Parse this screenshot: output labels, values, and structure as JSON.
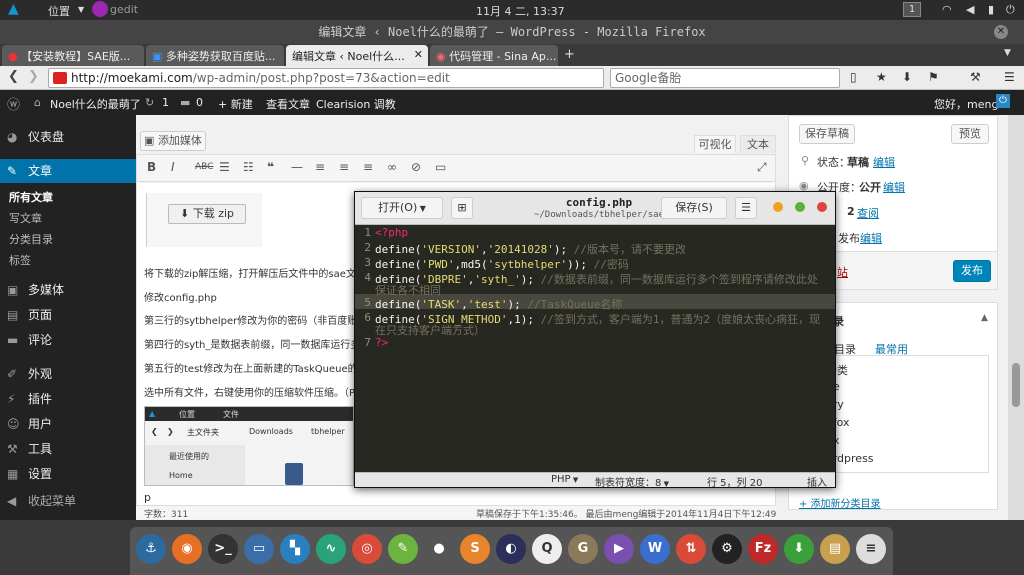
{
  "gnome": {
    "activities_icon": "arch-icon",
    "places": "位置",
    "app": "gedit",
    "clock": "11月 4 二, 13:37",
    "workspace": "1"
  },
  "window_title": "编辑文章 ‹ Noel什么的最萌了 — WordPress - Mozilla Firefox",
  "tabs": [
    {
      "label": "【安装教程】SAE版..."
    },
    {
      "label": "多种姿势获取百度贴..."
    },
    {
      "label": "编辑文章 ‹ Noel什么..."
    },
    {
      "label": "代码管理 - Sina Ap..."
    }
  ],
  "nav": {
    "url_host": "http://moekami.com",
    "url_path": "/wp-admin/post.php?post=73&action=edit",
    "search_text": "Google备胎"
  },
  "adminbar": {
    "site": "Noel什么的最萌了",
    "updates": "1",
    "comments": "0",
    "new": "+ 新建",
    "view": "查看文章",
    "plugin": "Clearision 调教",
    "greeting": "您好，meng"
  },
  "menu": {
    "dashboard": "仪表盘",
    "posts": "文章",
    "sub_all": "所有文章",
    "sub_write": "写文章",
    "sub_cat": "分类目录",
    "sub_tag": "标签",
    "media": "多媒体",
    "pages": "页面",
    "comments": "评论",
    "appearance": "外观",
    "plugins": "插件",
    "users": "用户",
    "tools": "工具",
    "settings": "设置",
    "collapse": "收起菜单"
  },
  "editor": {
    "add_media": "添加媒体",
    "visual": "可视化",
    "text": "文本",
    "download": "下载 zip",
    "p1": "将下载的zip解压缩，打开解压后文件中的sae文件",
    "p2": "修改config.php",
    "p3": "第三行的sytbhelper修改为你的密码（非百度账号",
    "p4": "第四行的syth_是数据表前缀，同一数据库运行多",
    "p5": "第五行的test修改为在上面新建的TaskQueue的名",
    "p6": "选中所有文件，右键使用你的压缩软件压缩。（P",
    "p_tag": "p",
    "word_count": "字数：311",
    "autosave": "草稿保存于下午1:35:46。 最后由meng编辑于2014年11月4日下午12:49"
  },
  "nested": {
    "places": "位置",
    "file_menu": "文件",
    "home_folder": "主文件夹",
    "downloads": "Downloads",
    "tbhelper": "tbhelper",
    "recent": "最近使用的",
    "home": "Home"
  },
  "side": {
    "save_draft": "保存草稿",
    "preview": "预览",
    "status_label": "状态：",
    "status_value": "草稿",
    "edit": "编辑",
    "visibility_label": "公开度：",
    "visibility_value": "公开",
    "revisions": "2",
    "browse": "查阅",
    "publish_time": "发布",
    "trash": "站",
    "publish": "发布",
    "cat_title": "录",
    "tab_all": "类目录",
    "tab_popular": "最常用",
    "cats": [
      "分类",
      "de",
      "ary",
      "efox",
      "ux",
      "ordpress"
    ],
    "add_cat": "+ 添加新分类目录"
  },
  "gedit": {
    "open": "打开(O)",
    "filename": "config.php",
    "path": "~/Downloads/tbhelper/sae",
    "save": "保存(S)",
    "lines": [
      "1",
      "2",
      "3",
      "4",
      "5",
      "6",
      "7"
    ],
    "status_lang": "PHP",
    "status_tab": "制表符宽度：8",
    "status_pos": "行 5，列 20",
    "status_ins": "插入"
  },
  "code": {
    "l1": "<?php",
    "l2_a": "define(",
    "l2_b": "'VERSION'",
    "l2_c": ",",
    "l2_d": "'20141028'",
    "l2_e": ");",
    "l2_f": " //版本号，请不要更改",
    "l3_a": "define(",
    "l3_b": "'PWD'",
    "l3_c": ",md5(",
    "l3_d": "'sytbhelper'",
    "l3_e": "));",
    "l3_f": " //密码",
    "l4_a": "define(",
    "l4_b": "'DBPRE'",
    "l4_c": ",",
    "l4_d": "'syth_'",
    "l4_e": ");",
    "l4_f": " //数据表前缀，同一数据库运行多个签到程序请修改此处",
    "l4_g": "保证各不相同",
    "l5_a": "define(",
    "l5_b": "'TASK'",
    "l5_c": ",",
    "l5_d": "'test'",
    "l5_e": ");",
    "l5_f": " //TaskQueue名称",
    "l6_a": "define(",
    "l6_b": "'SIGN_METHOD'",
    "l6_c": ",1);",
    "l6_f": " //签到方式，客户端为1，普通为2（度娘太丧心病狂，现",
    "l6_g": "在只支持客户端方式）",
    "l7": "?>"
  },
  "dock": [
    {
      "name": "anchor",
      "glyph": "⚓",
      "color": "#2c6aa0"
    },
    {
      "name": "firefox",
      "glyph": "◉",
      "color": "#e76f24"
    },
    {
      "name": "terminal",
      "glyph": ">_",
      "color": "#333"
    },
    {
      "name": "virtualbox",
      "glyph": "▭",
      "color": "#3b6ea8"
    },
    {
      "name": "system-monitor",
      "glyph": "▚",
      "color": "#2a7fbf"
    },
    {
      "name": "activity",
      "glyph": "∿",
      "color": "#2aa27a"
    },
    {
      "name": "chrome",
      "glyph": "◎",
      "color": "#d94a38"
    },
    {
      "name": "gedit",
      "glyph": "✎",
      "color": "#6cb33f"
    },
    {
      "name": "disks",
      "glyph": "●",
      "color": "#555"
    },
    {
      "name": "sublime",
      "glyph": "S",
      "color": "#e8842c"
    },
    {
      "name": "eclipse",
      "glyph": "◐",
      "color": "#2c2f5b"
    },
    {
      "name": "qq",
      "glyph": "Q",
      "color": "#eee"
    },
    {
      "name": "gimp",
      "glyph": "G",
      "color": "#8a7a5a"
    },
    {
      "name": "player",
      "glyph": "▶",
      "color": "#7a4fb0"
    },
    {
      "name": "wps",
      "glyph": "W",
      "color": "#3a6fcf"
    },
    {
      "name": "transfer",
      "glyph": "⇅",
      "color": "#d94a38"
    },
    {
      "name": "steam",
      "glyph": "⚙",
      "color": "#222"
    },
    {
      "name": "filezilla",
      "glyph": "Fz",
      "color": "#c0282a"
    },
    {
      "name": "download",
      "glyph": "⬇",
      "color": "#3aa03a"
    },
    {
      "name": "files",
      "glyph": "▤",
      "color": "#c8a050"
    },
    {
      "name": "notes",
      "glyph": "≡",
      "color": "#ddd"
    }
  ],
  "colors": {
    "accent": "#0073aa",
    "gedit_bg": "#272822",
    "string": "#e6db74",
    "comment": "#75715e"
  }
}
